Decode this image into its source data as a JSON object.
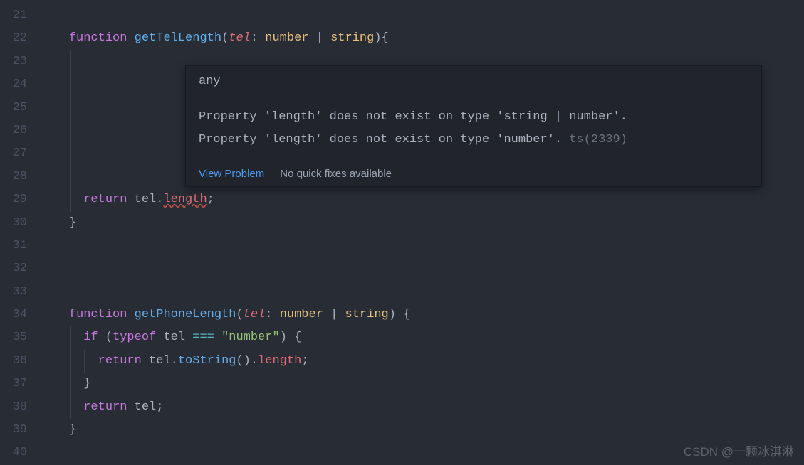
{
  "line_numbers": [
    "21",
    "22",
    "23",
    "24",
    "25",
    "26",
    "27",
    "28",
    "29",
    "30",
    "31",
    "32",
    "33",
    "34",
    "35",
    "36",
    "37",
    "38",
    "39",
    "40"
  ],
  "code": {
    "l22": {
      "kw_function": "function",
      "fn": "getTelLength",
      "lp": "(",
      "param": "tel",
      "colon": ": ",
      "type1": "number",
      "pipe": " | ",
      "type2": "string",
      "rp": ")",
      "brace": "{"
    },
    "l29": {
      "kw_return": "return",
      "ident": " tel",
      "dot": ".",
      "err_prop": "length",
      "semi": ";"
    },
    "l30": {
      "brace": "}"
    },
    "l34": {
      "kw_function": "function",
      "fn": "getPhoneLength",
      "lp": "(",
      "param": "tel",
      "colon": ": ",
      "type1": "number",
      "pipe": " | ",
      "type2": "string",
      "rp": ") ",
      "brace": "{"
    },
    "l35": {
      "kw_if": "if",
      "lp": " (",
      "kw_typeof": "typeof",
      "ident": " tel ",
      "op": "===",
      "sp": " ",
      "str": "\"number\"",
      "rp": ") ",
      "brace": "{"
    },
    "l36": {
      "kw_return": "return",
      "ident": " tel",
      "dot": ".",
      "fn": "toString",
      "call": "()",
      "dot2": ".",
      "prop": "length",
      "semi": ";"
    },
    "l37": {
      "brace": "}"
    },
    "l38": {
      "kw_return": "return",
      "ident": " tel",
      "semi": ";"
    },
    "l39": {
      "brace": "}"
    }
  },
  "tooltip": {
    "signature": "any",
    "msg_line1": "Property 'length' does not exist on type 'string | number'.",
    "msg_line2_indent": "  ",
    "msg_line2": "Property 'length' does not exist on type 'number'.",
    "ts_code": " ts(2339)",
    "view_problem": "View Problem",
    "no_fix": "No quick fixes available"
  },
  "watermark": "CSDN @一颗冰淇淋"
}
